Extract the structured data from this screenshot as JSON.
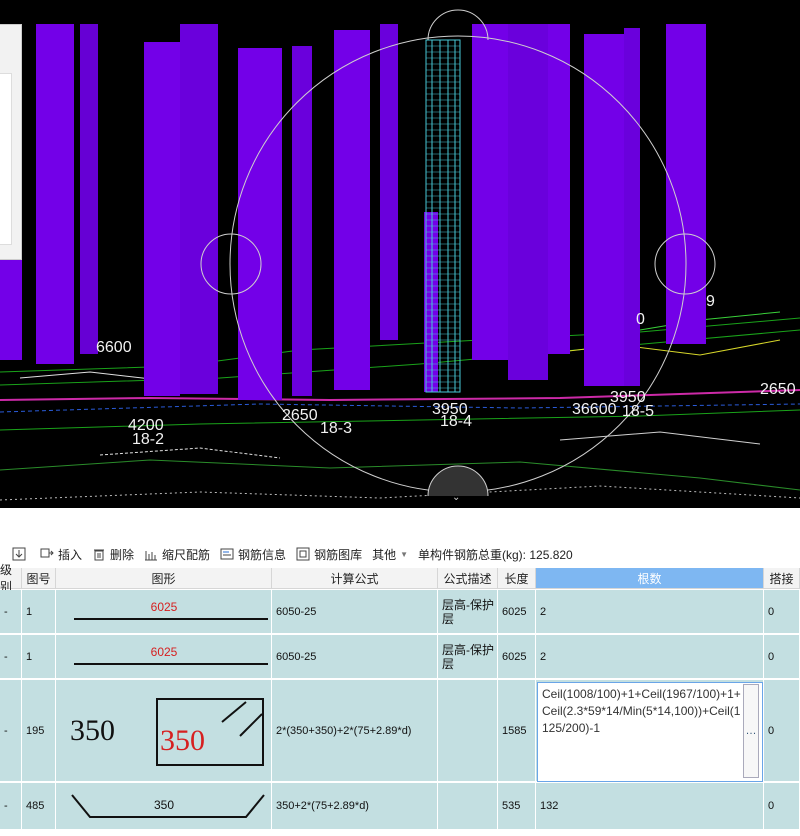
{
  "viewport": {
    "labels": [
      {
        "text": "6600"
      },
      {
        "text": "4200"
      },
      {
        "text": "18-2"
      },
      {
        "text": "2650"
      },
      {
        "text": "18-3"
      },
      {
        "text": "3950"
      },
      {
        "text": "18-4"
      },
      {
        "text": "3950"
      },
      {
        "text": "36600"
      },
      {
        "text": "18-5"
      },
      {
        "text": "2650"
      },
      {
        "text": "9"
      },
      {
        "text": "0"
      }
    ],
    "colors": {
      "column": "#7300e8",
      "background": "#000000",
      "rebar": "#49c8d6"
    }
  },
  "toolbar": {
    "items": [
      {
        "name": "download-icon",
        "label": ""
      },
      {
        "name": "insert-button",
        "label": "插入"
      },
      {
        "name": "delete-button",
        "label": "删除"
      },
      {
        "name": "scale-rebar-button",
        "label": "缩尺配筋"
      },
      {
        "name": "rebar-info-button",
        "label": "钢筋信息"
      },
      {
        "name": "rebar-library-button",
        "label": "钢筋图库"
      },
      {
        "name": "other-menu",
        "label": "其他"
      }
    ],
    "total_label": "单构件钢筋总重(kg): 125.820"
  },
  "table": {
    "headers": [
      "级别",
      "图号",
      "图形",
      "计算公式",
      "公式描述",
      "长度",
      "根数",
      "搭接"
    ],
    "rows": [
      {
        "level": "-",
        "fig_no": "1",
        "shape_value": "6025",
        "formula": "6050-25",
        "desc": "层高-保护层",
        "length": "6025",
        "count": "2",
        "lap": "0"
      },
      {
        "level": "-",
        "fig_no": "1",
        "shape_value": "6025",
        "formula": "6050-25",
        "desc": "层高-保护层",
        "length": "6025",
        "count": "2",
        "lap": "0"
      },
      {
        "level": "-",
        "fig_no": "195",
        "shape_left": "350",
        "shape_right": "350",
        "formula": "2*(350+350)+2*(75+2.89*d)",
        "desc": "",
        "length": "1585",
        "count": "Ceil(1008/100)+1+Ceil(1967/100)+1+Ceil(2.3*59*14/Min(5*14,100))+Ceil(1125/200)-1",
        "lap": "0"
      },
      {
        "level": "-",
        "fig_no": "485",
        "shape_value": "350",
        "formula": "350+2*(75+2.89*d)",
        "desc": "",
        "length": "535",
        "count": "132",
        "lap": "0"
      }
    ]
  }
}
